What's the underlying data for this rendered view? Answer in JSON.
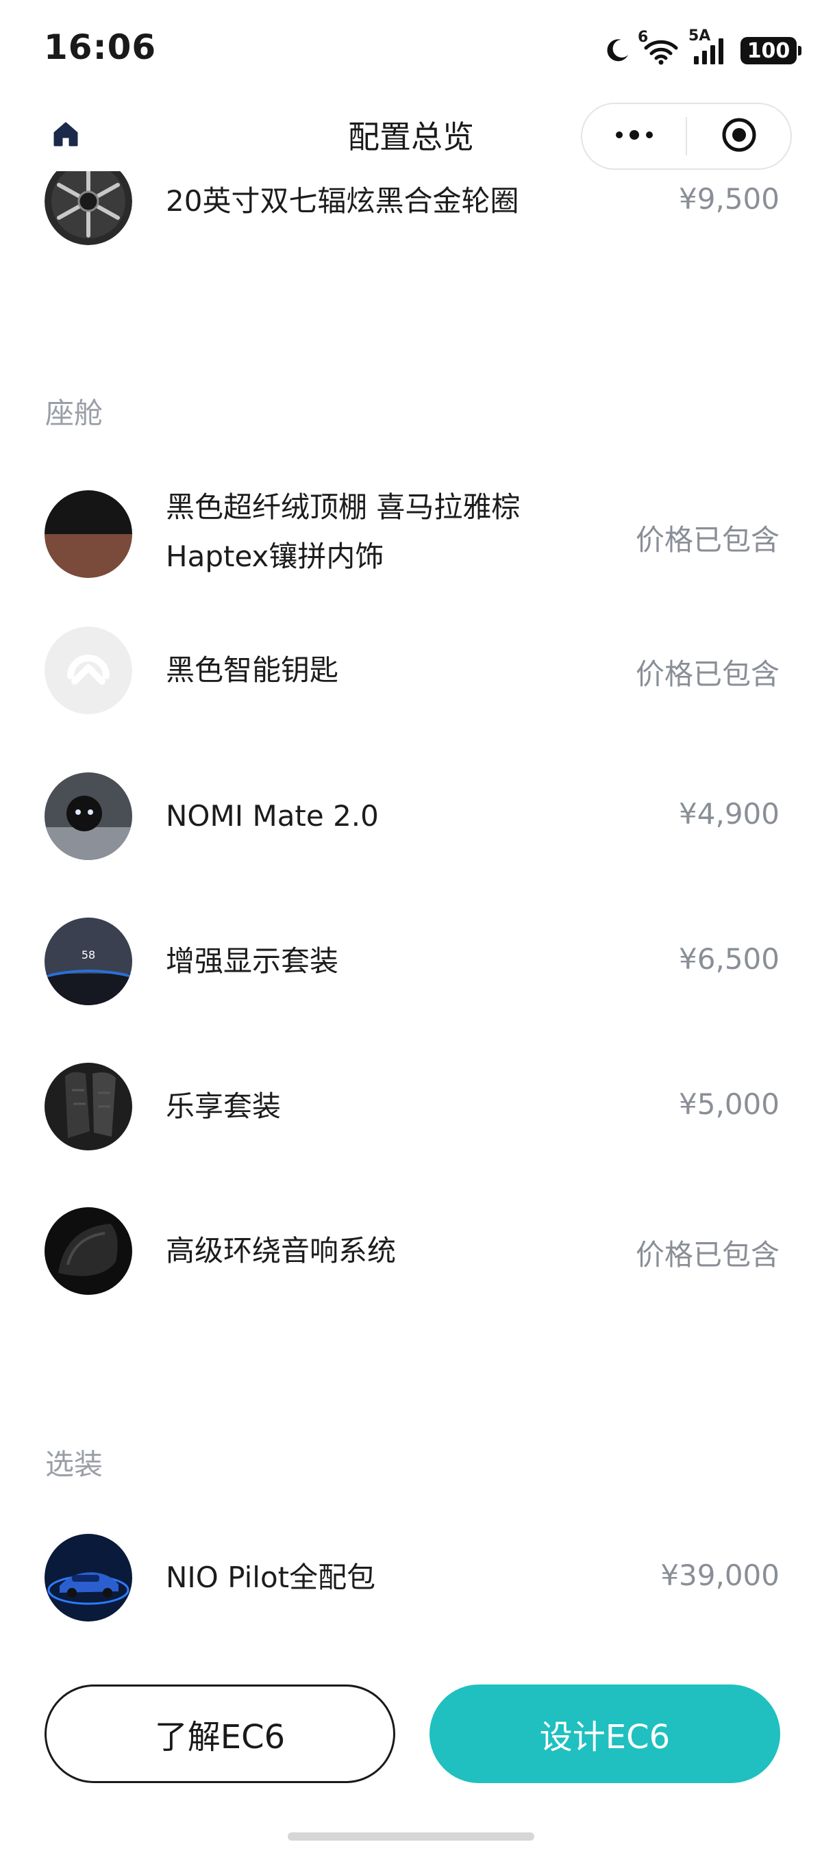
{
  "status_bar": {
    "time": "16:06",
    "network_label": "5A",
    "wifi_label": "6",
    "battery": "100"
  },
  "nav": {
    "title": "配置总览",
    "home_icon": "home-icon",
    "more_icon": "more-dots-icon",
    "close_icon": "target-close-icon"
  },
  "top_item": {
    "name": "20英寸双七辐炫黑合金轮圈",
    "price": "¥9,500",
    "thumb": "wheel-thumb"
  },
  "sections": {
    "cabin": {
      "title": "座舱",
      "items": [
        {
          "name_line1": "黑色超纤绒顶棚 喜马拉雅棕",
          "name_line2": "Haptex镶拼内饰",
          "price": "价格已包含",
          "thumb": "interior-trim-thumb"
        },
        {
          "name": "黑色智能钥匙",
          "price": "价格已包含",
          "thumb": "smart-key-thumb"
        },
        {
          "name": "NOMI Mate 2.0",
          "price": "¥4,900",
          "thumb": "nomi-thumb"
        },
        {
          "name": "增强显示套装",
          "price": "¥6,500",
          "thumb": "hud-display-thumb",
          "thumb_text": "58"
        },
        {
          "name": "乐享套装",
          "price": "¥5,000",
          "thumb": "seat-package-thumb"
        },
        {
          "name": "高级环绕音响系统",
          "price": "价格已包含",
          "thumb": "speaker-thumb"
        }
      ]
    },
    "options": {
      "title": "选装",
      "items": [
        {
          "name": "NIO Pilot全配包",
          "price": "¥39,000",
          "thumb": "nio-pilot-thumb"
        }
      ]
    }
  },
  "buttons": {
    "learn": "了解EC6",
    "design": "设计EC6"
  },
  "colors": {
    "accent": "#1fc0bf",
    "muted_text": "#8a8e96",
    "section_title": "#9a9ea6",
    "home_icon": "#1b2a4a"
  }
}
